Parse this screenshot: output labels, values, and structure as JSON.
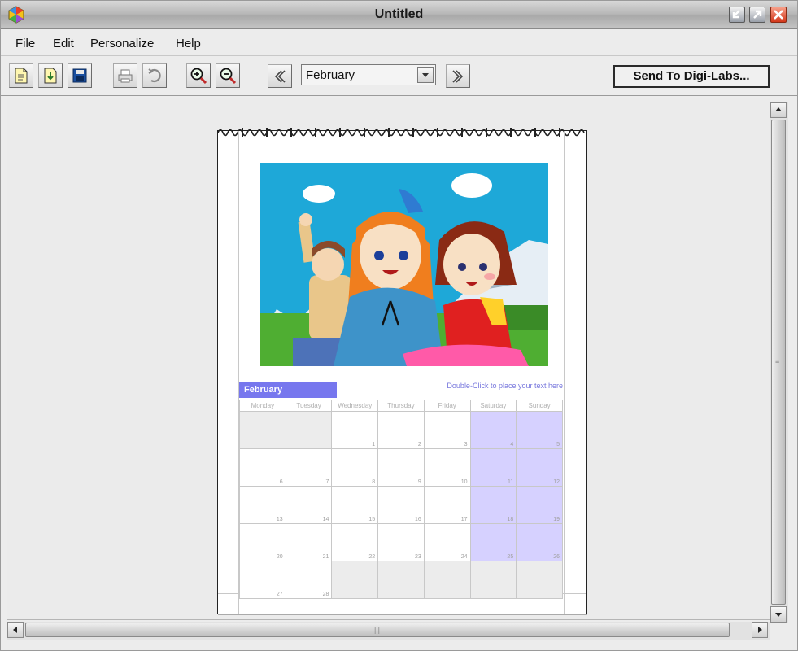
{
  "window": {
    "title": "Untitled",
    "colors": {
      "accent": "#7777ee",
      "weekend": "#d6d1ff",
      "close_button": "#d3371a"
    }
  },
  "menubar": {
    "items": [
      {
        "label": "File"
      },
      {
        "label": "Edit"
      },
      {
        "label": "Personalize"
      },
      {
        "label": "Help"
      }
    ]
  },
  "toolbar": {
    "buttons": [
      {
        "icon": "new-document-icon"
      },
      {
        "icon": "open-document-icon"
      },
      {
        "icon": "save-disk-icon"
      },
      {
        "icon": "print-icon"
      },
      {
        "icon": "undo-icon"
      },
      {
        "icon": "zoom-in-icon"
      },
      {
        "icon": "zoom-out-icon"
      },
      {
        "icon": "previous-month-icon"
      },
      {
        "icon": "next-month-icon"
      }
    ],
    "month_select": {
      "value": "February"
    },
    "send_button": "Send To Digi-Labs..."
  },
  "calendar": {
    "month_name": "February",
    "caption": "Double-Click to place your text here",
    "weekdays": [
      "Monday",
      "Tuesday",
      "Wednesday",
      "Thursday",
      "Friday",
      "Saturday",
      "Sunday"
    ],
    "weeks": [
      [
        "",
        "",
        "1",
        "2",
        "3",
        "4",
        "5"
      ],
      [
        "6",
        "7",
        "8",
        "9",
        "10",
        "11",
        "12"
      ],
      [
        "13",
        "14",
        "15",
        "16",
        "17",
        "18",
        "19"
      ],
      [
        "20",
        "21",
        "22",
        "23",
        "24",
        "25",
        "26"
      ],
      [
        "27",
        "28",
        "",
        "",
        "",
        "",
        ""
      ]
    ],
    "photo": {
      "icon": "cartoon-children-photo"
    }
  }
}
